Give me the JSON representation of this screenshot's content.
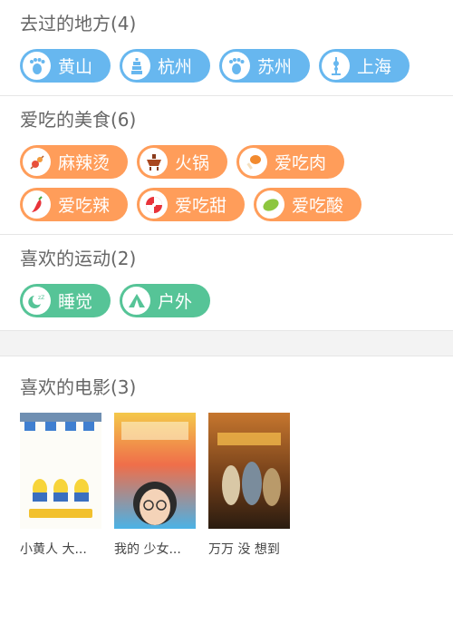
{
  "places": {
    "title": "去过的地方(4)",
    "color": "#67b7ef",
    "items": [
      {
        "label": "黄山",
        "icon": "footprint-icon"
      },
      {
        "label": "杭州",
        "icon": "pagoda-icon"
      },
      {
        "label": "苏州",
        "icon": "footprint-icon"
      },
      {
        "label": "上海",
        "icon": "tower-icon"
      }
    ]
  },
  "foods": {
    "title": "爱吃的美食(6)",
    "color": "#ff9d5a",
    "items": [
      {
        "label": "麻辣烫",
        "icon": "skewer-icon"
      },
      {
        "label": "火锅",
        "icon": "hotpot-icon"
      },
      {
        "label": "爱吃肉",
        "icon": "drumstick-icon"
      },
      {
        "label": "爱吃辣",
        "icon": "chili-icon"
      },
      {
        "label": "爱吃甜",
        "icon": "candy-icon"
      },
      {
        "label": "爱吃酸",
        "icon": "lemon-icon"
      }
    ]
  },
  "sports": {
    "title": "喜欢的运动(2)",
    "color": "#56c497",
    "items": [
      {
        "label": "睡觉",
        "icon": "sleep-icon"
      },
      {
        "label": "户外",
        "icon": "tent-icon"
      }
    ]
  },
  "movies": {
    "title": "喜欢的电影(3)",
    "items": [
      {
        "label": "小黄人 大..."
      },
      {
        "label": "我的 少女..."
      },
      {
        "label": "万万 没 想到"
      }
    ]
  }
}
